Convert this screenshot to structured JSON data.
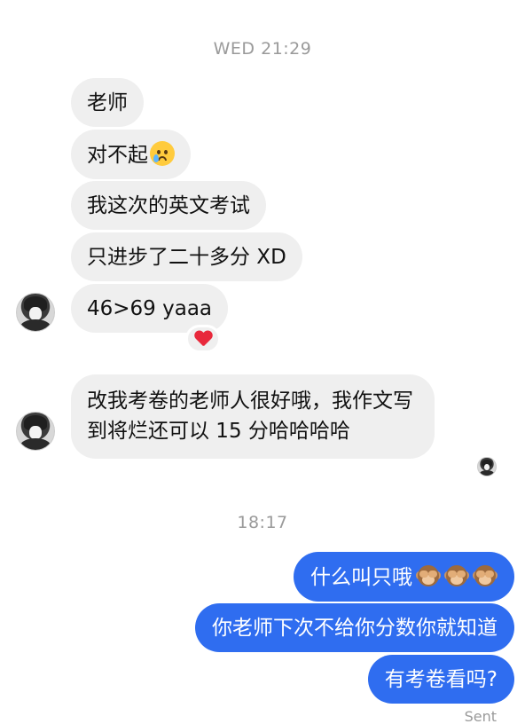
{
  "timestamps": {
    "first": "WED 21:29",
    "second": "18:17"
  },
  "incoming": {
    "messages": [
      {
        "text": "老师"
      },
      {
        "text": "对不起",
        "emoji": "crying-face-icon"
      },
      {
        "text": "我这次的英文考试"
      },
      {
        "text": "只进步了二十多分 XD"
      },
      {
        "text": "46>69 yaaa",
        "reaction": "heart-icon"
      },
      {
        "text": "改我考卷的老师人很好哦，我作文写到将烂还可以 15 分哈哈哈哈"
      }
    ]
  },
  "outgoing": {
    "messages": [
      {
        "text": "什么叫只哦",
        "emoji": "see-no-evil-monkey-icon",
        "emoji_count": 3
      },
      {
        "text": "你老师下次不给你分数你就知道"
      },
      {
        "text": "有考卷看吗?"
      }
    ],
    "status": "Sent"
  },
  "colors": {
    "incoming_bubble": "#efefef",
    "outgoing_bubble": "#2f6df0",
    "timestamp": "#9a9a9a",
    "heart": "#e8283b"
  }
}
